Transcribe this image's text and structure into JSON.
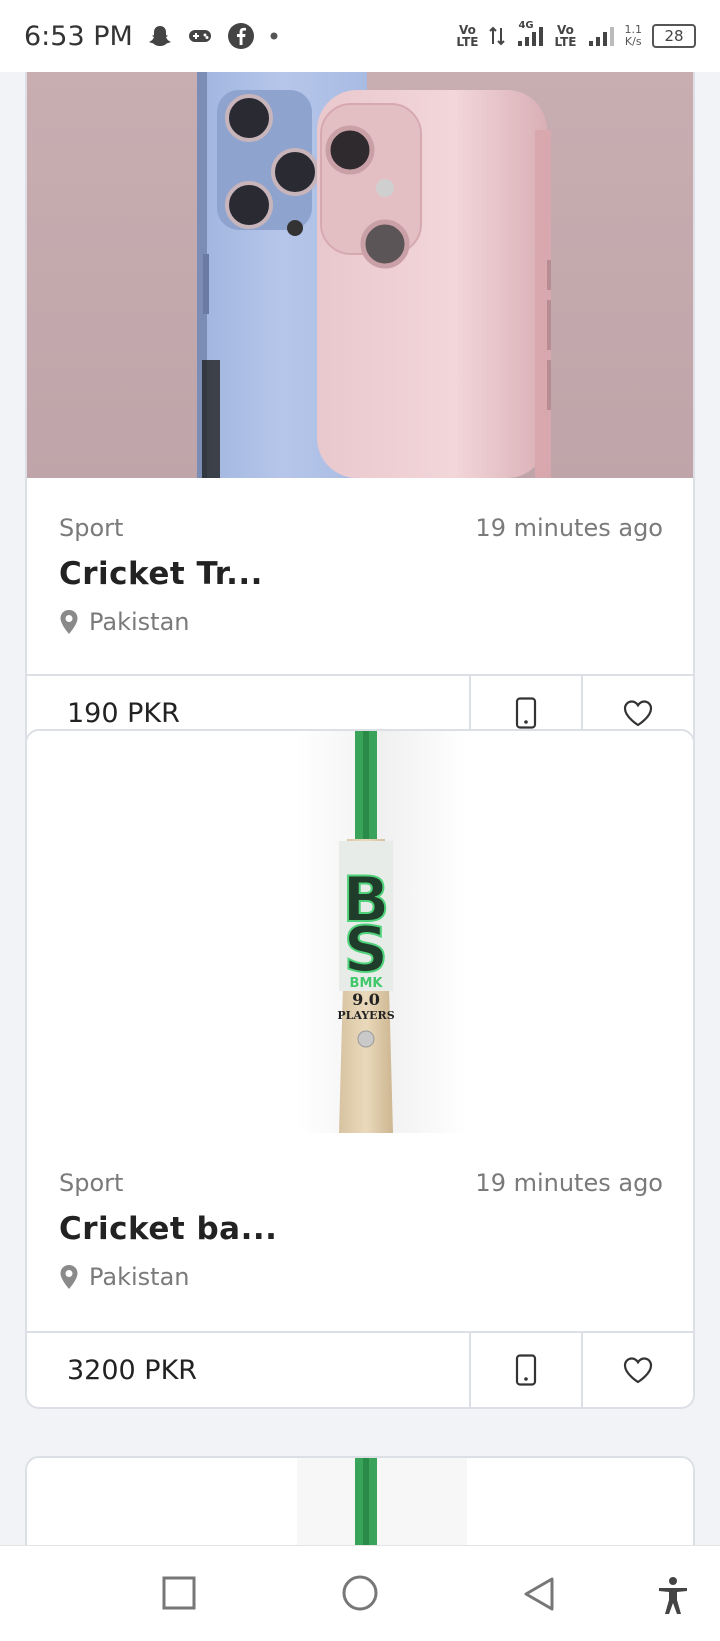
{
  "status_bar": {
    "time": "6:53 PM",
    "net_labels": [
      "Vo\nLTE",
      "4G",
      "Vo\nLTE"
    ],
    "speed_value": "1.1",
    "speed_unit": "K/s",
    "battery": "28"
  },
  "listings": [
    {
      "category": "Sport",
      "time_ago": "19 minutes ago",
      "title": "Cricket Tr...",
      "location": "Pakistan",
      "price": "190 PKR",
      "image": "phones-photo"
    },
    {
      "category": "Sport",
      "time_ago": "19 minutes ago",
      "title": "Cricket ba...",
      "location": "Pakistan",
      "price": "3200 PKR",
      "image": "cricket-bat-photo",
      "bat_text": {
        "brand": "BMK",
        "model": "9.0",
        "grade": "PLAYERS"
      }
    }
  ],
  "colors": {
    "background": "#f2f3f6",
    "card_border": "#dcdfe5",
    "muted_text": "#7a7a7a"
  },
  "icons": {
    "location": "map-pin-icon",
    "call": "phone-icon",
    "favorite": "heart-icon"
  }
}
